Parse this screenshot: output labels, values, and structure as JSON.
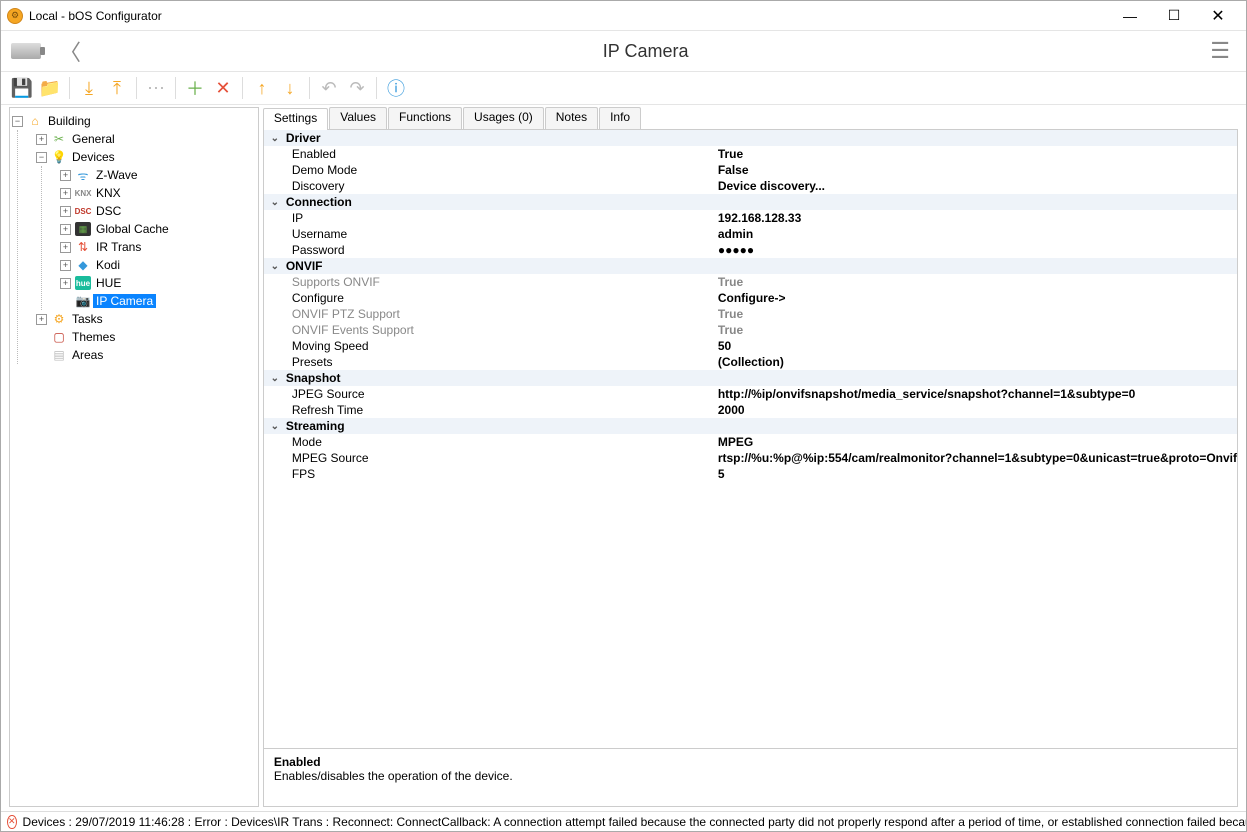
{
  "window": {
    "title": "Local - bOS Configurator"
  },
  "header": {
    "title": "IP Camera"
  },
  "tree": {
    "root": "Building",
    "general": "General",
    "devices": "Devices",
    "device_items": {
      "zwave": "Z-Wave",
      "knx": "KNX",
      "dsc": "DSC",
      "globalcache": "Global Cache",
      "irtrans": "IR Trans",
      "kodi": "Kodi",
      "hue": "HUE",
      "ipcamera": "IP Camera"
    },
    "tasks": "Tasks",
    "themes": "Themes",
    "areas": "Areas"
  },
  "tabs": {
    "settings": "Settings",
    "values": "Values",
    "functions": "Functions",
    "usages": "Usages (0)",
    "notes": "Notes",
    "info": "Info"
  },
  "props": {
    "driver": {
      "label": "Driver"
    },
    "enabled": {
      "label": "Enabled",
      "value": "True"
    },
    "demoMode": {
      "label": "Demo Mode",
      "value": "False"
    },
    "discovery": {
      "label": "Discovery",
      "value": "Device discovery..."
    },
    "connection": {
      "label": "Connection"
    },
    "ip": {
      "label": "IP",
      "value": "192.168.128.33"
    },
    "username": {
      "label": "Username",
      "value": "admin"
    },
    "password": {
      "label": "Password",
      "value": "●●●●●"
    },
    "onvif": {
      "label": "ONVIF"
    },
    "supportsOnvif": {
      "label": "Supports ONVIF",
      "value": "True"
    },
    "configure": {
      "label": "Configure",
      "value": "Configure->"
    },
    "ptz": {
      "label": "ONVIF PTZ Support",
      "value": "True"
    },
    "events": {
      "label": "ONVIF Events Support",
      "value": "True"
    },
    "moving": {
      "label": "Moving Speed",
      "value": "50"
    },
    "presets": {
      "label": "Presets",
      "value": "(Collection)"
    },
    "snapshot": {
      "label": "Snapshot"
    },
    "jpeg": {
      "label": "JPEG Source",
      "value": "http://%ip/onvifsnapshot/media_service/snapshot?channel=1&subtype=0"
    },
    "refresh": {
      "label": "Refresh Time",
      "value": "2000"
    },
    "streaming": {
      "label": "Streaming"
    },
    "mode": {
      "label": "Mode",
      "value": "MPEG"
    },
    "mpeg": {
      "label": "MPEG Source",
      "value": "rtsp://%u:%p@%ip:554/cam/realmonitor?channel=1&subtype=0&unicast=true&proto=Onvif"
    },
    "fps": {
      "label": "FPS",
      "value": "5"
    }
  },
  "help": {
    "title": "Enabled",
    "text": "Enables/disables the operation of the device."
  },
  "status": {
    "text": "Devices : 29/07/2019 11:46:28 : Error : Devices\\IR Trans : Reconnect: ConnectCallback: A connection attempt failed because the connected party did not properly respond after a period of time, or established connection failed because"
  }
}
